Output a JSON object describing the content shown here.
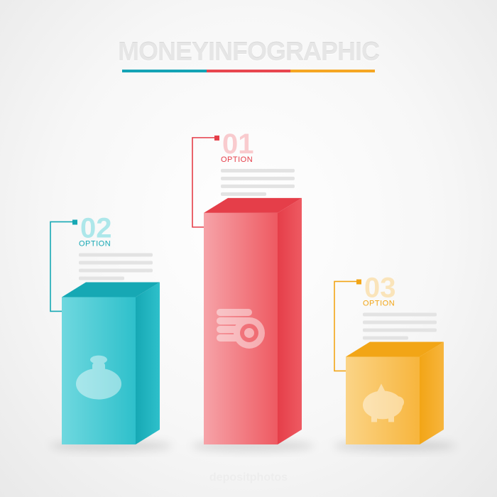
{
  "title": {
    "part1": "MONEY",
    "part2": "INFOGRAPHIC"
  },
  "title_rule_colors": [
    "#14a3b5",
    "#e8464f",
    "#f5a623"
  ],
  "chart_data": {
    "type": "bar",
    "categories": [
      "02",
      "01",
      "03"
    ],
    "values": [
      210,
      330,
      125
    ],
    "ylim": [
      0,
      340
    ],
    "option_label": "OPTION",
    "bars": [
      {
        "number": "02",
        "label": "OPTION",
        "color": "#2ec0cb",
        "color_dark": "#16a8b4",
        "color_light": "#6fd8df",
        "icon": "money-bag-icon"
      },
      {
        "number": "01",
        "label": "OPTION",
        "color": "#ee5a62",
        "color_dark": "#e53e49",
        "color_light": "#f6a3a8",
        "icon": "coins-stack-icon"
      },
      {
        "number": "03",
        "label": "OPTION",
        "color": "#f7b53d",
        "color_dark": "#f2a516",
        "color_light": "#fbd487",
        "icon": "piggy-bank-icon"
      }
    ]
  },
  "watermark": "depositphotos"
}
